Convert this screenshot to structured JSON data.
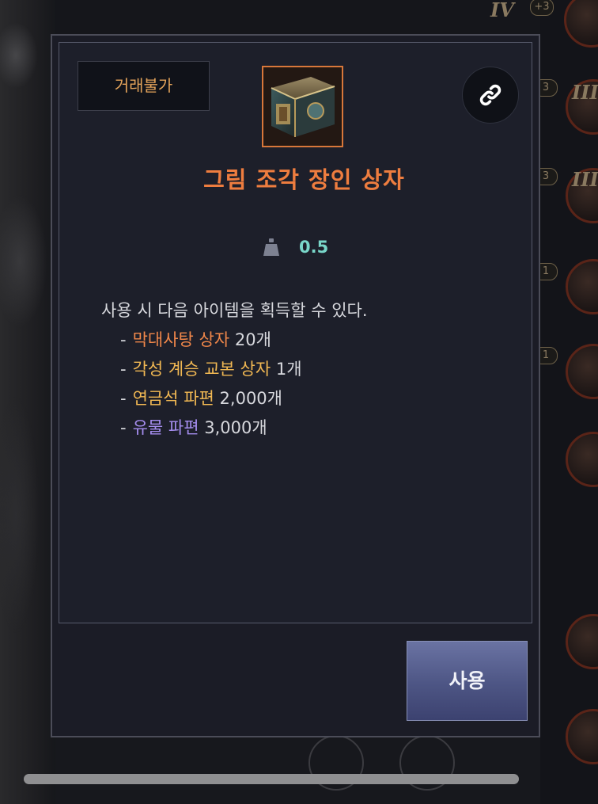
{
  "popup": {
    "trade_badge": "거래불가",
    "item_icon": "treasure-chest-icon",
    "link_icon": "link-icon",
    "title": "그림 조각 장인 상자",
    "weight": {
      "icon": "weight-icon",
      "value": "0.5"
    },
    "description": {
      "intro": "사용 시 다음 아이템을 획득할 수 있다.",
      "items": [
        {
          "dash": "-",
          "name": "막대사탕 상자",
          "count": "20개",
          "color": "#f0874a"
        },
        {
          "dash": "-",
          "name": "각성 계승 교본 상자",
          "count": "1개",
          "color": "#f1b853"
        },
        {
          "dash": "-",
          "name": "연금석 파편",
          "count": "2,000개",
          "color": "#f1b853"
        },
        {
          "dash": "-",
          "name": "유물 파편",
          "count": "3,000개",
          "color": "#a68ef0"
        }
      ]
    },
    "use_button": "사용"
  },
  "background": {
    "right_slots": [
      {
        "roman": "IV",
        "badge": "+3"
      },
      {
        "roman": "III",
        "badge": "3"
      },
      {
        "roman": "III",
        "badge": "3"
      },
      {
        "roman": "",
        "badge": "1"
      },
      {
        "roman": "",
        "badge": "1"
      }
    ]
  },
  "colors": {
    "title": "#ee7d3f",
    "trade_badge_text": "#e3a35a",
    "weight_value": "#79d6c9",
    "button": "#4d5584"
  }
}
